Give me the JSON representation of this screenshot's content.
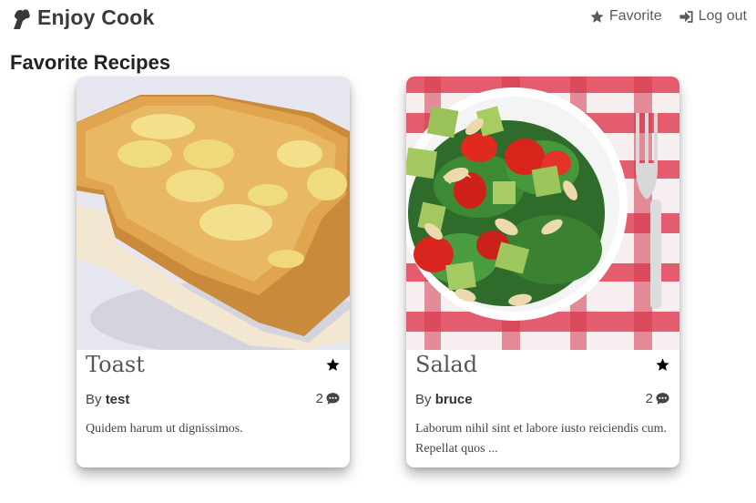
{
  "header": {
    "brand": "Enjoy Cook",
    "nav": [
      {
        "label": "Favorite",
        "icon": "star-icon"
      },
      {
        "label": "Log out",
        "icon": "sign-out-icon"
      }
    ]
  },
  "page": {
    "title": "Favorite Recipes"
  },
  "recipes": [
    {
      "title": "Toast",
      "by": "By",
      "author": "test",
      "comments": "2",
      "description": "Quidem harum ut dignissimos.",
      "image": "toast-photo",
      "favorite": true
    },
    {
      "title": "Salad",
      "by": "By",
      "author": "bruce",
      "comments": "2",
      "description": "Laborum nihil sint et labore iusto reiciendis cum. Repellat quos ...",
      "image": "salad-photo",
      "favorite": true
    }
  ],
  "colors": {
    "text": "#444444",
    "nav": "#5a5a5a",
    "star": "#000000"
  }
}
